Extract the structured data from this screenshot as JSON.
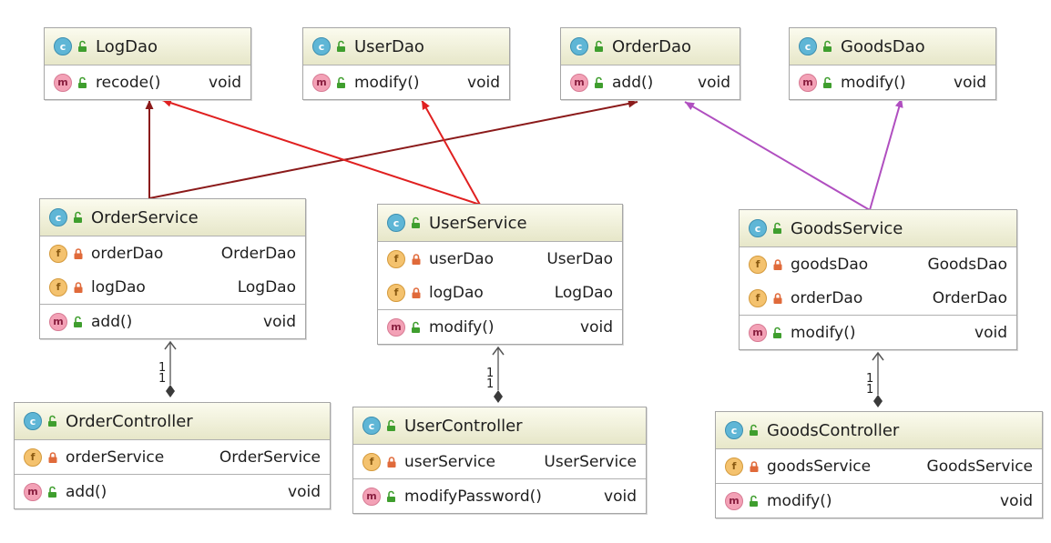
{
  "classes": {
    "logdao": {
      "name": "LogDao",
      "fields": [],
      "methods": [
        {
          "name": "recode()",
          "type": "void"
        }
      ]
    },
    "userdao": {
      "name": "UserDao",
      "fields": [],
      "methods": [
        {
          "name": "modify()",
          "type": "void"
        }
      ]
    },
    "orderdao": {
      "name": "OrderDao",
      "fields": [],
      "methods": [
        {
          "name": "add()",
          "type": "void"
        }
      ]
    },
    "goodsdao": {
      "name": "GoodsDao",
      "fields": [],
      "methods": [
        {
          "name": "modify()",
          "type": "void"
        }
      ]
    },
    "orderservice": {
      "name": "OrderService",
      "fields": [
        {
          "name": "orderDao",
          "type": "OrderDao"
        },
        {
          "name": "logDao",
          "type": "LogDao"
        }
      ],
      "methods": [
        {
          "name": "add()",
          "type": "void"
        }
      ]
    },
    "userservice": {
      "name": "UserService",
      "fields": [
        {
          "name": "userDao",
          "type": "UserDao"
        },
        {
          "name": "logDao",
          "type": "LogDao"
        }
      ],
      "methods": [
        {
          "name": "modify()",
          "type": "void"
        }
      ]
    },
    "goodsservice": {
      "name": "GoodsService",
      "fields": [
        {
          "name": "goodsDao",
          "type": "GoodsDao"
        },
        {
          "name": "orderDao",
          "type": "OrderDao"
        }
      ],
      "methods": [
        {
          "name": "modify()",
          "type": "void"
        }
      ]
    },
    "ordercontroller": {
      "name": "OrderController",
      "fields": [
        {
          "name": "orderService",
          "type": "OrderService"
        }
      ],
      "methods": [
        {
          "name": "add()",
          "type": "void"
        }
      ]
    },
    "usercontroller": {
      "name": "UserController",
      "fields": [
        {
          "name": "userService",
          "type": "UserService"
        }
      ],
      "methods": [
        {
          "name": "modifyPassword()",
          "type": "void"
        }
      ]
    },
    "goodscontroller": {
      "name": "GoodsController",
      "fields": [
        {
          "name": "goodsService",
          "type": "GoodsService"
        }
      ],
      "methods": [
        {
          "name": "modify()",
          "type": "void"
        }
      ]
    }
  },
  "badges": {
    "class": "c",
    "method": "m",
    "field": "f"
  },
  "multiplicity": {
    "source": "1",
    "target": "1"
  },
  "colors": {
    "dark_red": "#8b1a1a",
    "red": "#e02020",
    "purple": "#b04fc0",
    "gray": "#555555"
  }
}
